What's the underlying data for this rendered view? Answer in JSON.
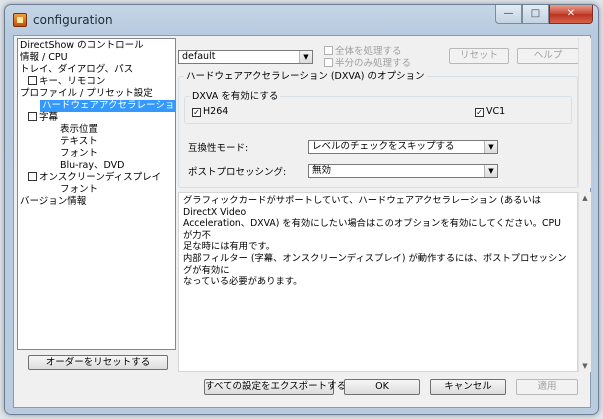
{
  "window": {
    "title": "configuration",
    "minimize_glyph": "—",
    "maximize_glyph": "□",
    "close_glyph": "✕"
  },
  "tree": {
    "items": [
      {
        "label": "DirectShow のコントロール",
        "checkbox": false,
        "selected": false
      },
      {
        "label": "情報 / CPU",
        "checkbox": false,
        "selected": false
      },
      {
        "label": "トレイ、ダイアログ、パス",
        "checkbox": false,
        "selected": false
      },
      {
        "label": "キー、リモコン",
        "checkbox": true,
        "selected": false
      },
      {
        "label": "プロファイル / プリセット設定",
        "checkbox": false,
        "selected": false
      },
      {
        "label": "ハードウェアアクセラレーション",
        "checkbox": false,
        "selected": true
      },
      {
        "label": "字幕",
        "checkbox": true,
        "selected": false
      },
      {
        "label": "表示位置",
        "checkbox": false,
        "selected": false
      },
      {
        "label": "テキスト",
        "checkbox": false,
        "selected": false
      },
      {
        "label": "フォント",
        "checkbox": false,
        "selected": false
      },
      {
        "label": "Blu-ray、DVD",
        "checkbox": false,
        "selected": false
      },
      {
        "label": "オンスクリーンディスプレイ",
        "checkbox": true,
        "selected": false
      },
      {
        "label": "フォント",
        "checkbox": false,
        "selected": false
      },
      {
        "label": "バージョン情報",
        "checkbox": false,
        "selected": false
      }
    ],
    "reset_button": "オーダーをリセットする"
  },
  "preset": {
    "value": "default",
    "process_all": "全体を処理する",
    "process_half": "半分のみ処理する",
    "reset_button": "リセット",
    "help_button": "ヘルプ"
  },
  "dxva": {
    "group_title": "ハードウェアアクセラレーション (DXVA) のオプション",
    "enable_title": "DXVA を有効にする",
    "h264_label": "H264",
    "h264_checked": "✓",
    "vc1_label": "VC1",
    "vc1_checked": "✓",
    "compat_label": "互換性モード:",
    "compat_value": "レベルのチェックをスキップする",
    "postproc_label": "ポストプロセッシング:",
    "postproc_value": "無効"
  },
  "description": "グラフィックカードがサポートしていて、ハードウェアアクセラレーション (あるいは DirectX Video\nAcceleration、DXVA) を有効にしたい場合はこのオプションを有効にしてください。CPU が力不\n足な時には有用です。\n内部フィルター (字幕、オンスクリーンディスプレイ) が動作するには、ポストプロセッシングが有効に\nなっている必要があります。",
  "buttons": {
    "export": "すべての設定をエクスポートする",
    "ok": "OK",
    "cancel": "キャンセル",
    "apply": "適用"
  },
  "colors": {
    "selection": "#3399ff",
    "titlebar": "#b9cce0",
    "close_button": "#c84530"
  }
}
